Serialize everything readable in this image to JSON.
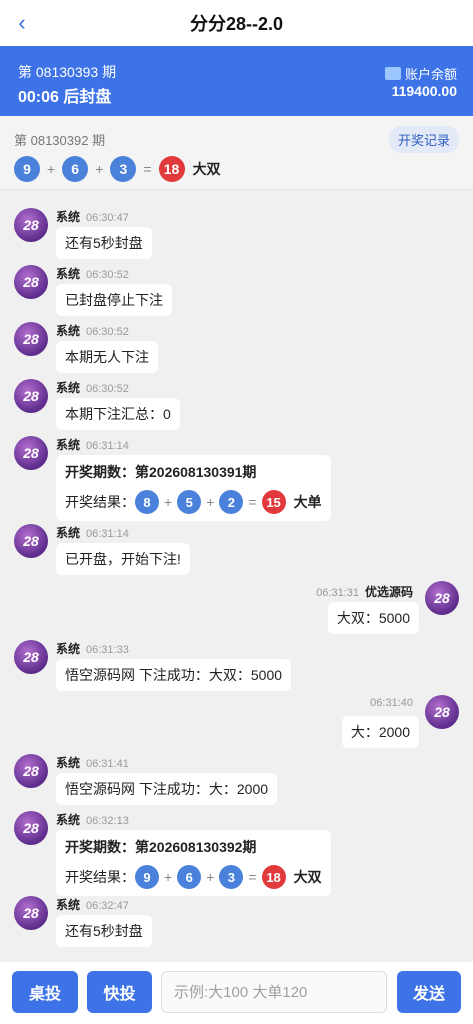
{
  "header": {
    "title": "分分28--2.0",
    "back_icon": "chevron-left-icon"
  },
  "period": {
    "current": "第 08130393 期",
    "countdown": "00:06 后封盘",
    "balance_label": "账户余额",
    "balance_value": "119400.00"
  },
  "last_result": {
    "period": "第 08130392 期",
    "record_button": "开奖记录",
    "balls": [
      "9",
      "6",
      "3"
    ],
    "sum": "18",
    "tag": "大双",
    "plus": "+",
    "equals": "="
  },
  "chat": {
    "partial_top": "",
    "messages": [
      {
        "side": "left",
        "sender": "系统",
        "time": "06:30:47",
        "text": "还有5秒封盘"
      },
      {
        "side": "left",
        "sender": "系统",
        "time": "06:30:52",
        "text": "已封盘停止下注"
      },
      {
        "side": "left",
        "sender": "系统",
        "time": "06:30:52",
        "text": "本期无人下注"
      },
      {
        "side": "left",
        "sender": "系统",
        "time": "06:30:52",
        "text": "本期下注汇总：0"
      },
      {
        "side": "left",
        "sender": "系统",
        "time": "06:31:14",
        "draw_title": "开奖期数：第202608130391期",
        "draw_label": "开奖结果：",
        "balls": [
          "8",
          "5",
          "2"
        ],
        "sum": "15",
        "tag": "大单"
      },
      {
        "side": "left",
        "sender": "系统",
        "time": "06:31:14",
        "text": "已开盘，开始下注!"
      },
      {
        "side": "right",
        "sender": "优选源码",
        "time": "06:31:31",
        "text": "大双：5000"
      },
      {
        "side": "left",
        "sender": "系统",
        "time": "06:31:33",
        "text": "悟空源码网 下注成功：大双：5000"
      },
      {
        "side": "right",
        "sender": "",
        "time": "06:31:40",
        "text": "大：2000"
      },
      {
        "side": "left",
        "sender": "系统",
        "time": "06:31:41",
        "text": "悟空源码网 下注成功：大：2000"
      },
      {
        "side": "left",
        "sender": "系统",
        "time": "06:32:13",
        "draw_title": "开奖期数：第202608130392期",
        "draw_label": "开奖结果：",
        "balls": [
          "9",
          "6",
          "3"
        ],
        "sum": "18",
        "tag": "大双"
      },
      {
        "side": "left",
        "sender": "系统",
        "time": "06:32:47",
        "text": "还有5秒封盘"
      }
    ],
    "avatar_text": "28"
  },
  "bottom": {
    "desk_button": "桌投",
    "fast_button": "快投",
    "input_placeholder": "示例:大100 大单120",
    "send_button": "发送"
  },
  "colors": {
    "accent": "#3d73e7",
    "ball_blue": "#4a82db",
    "ball_red": "#e1393c"
  }
}
